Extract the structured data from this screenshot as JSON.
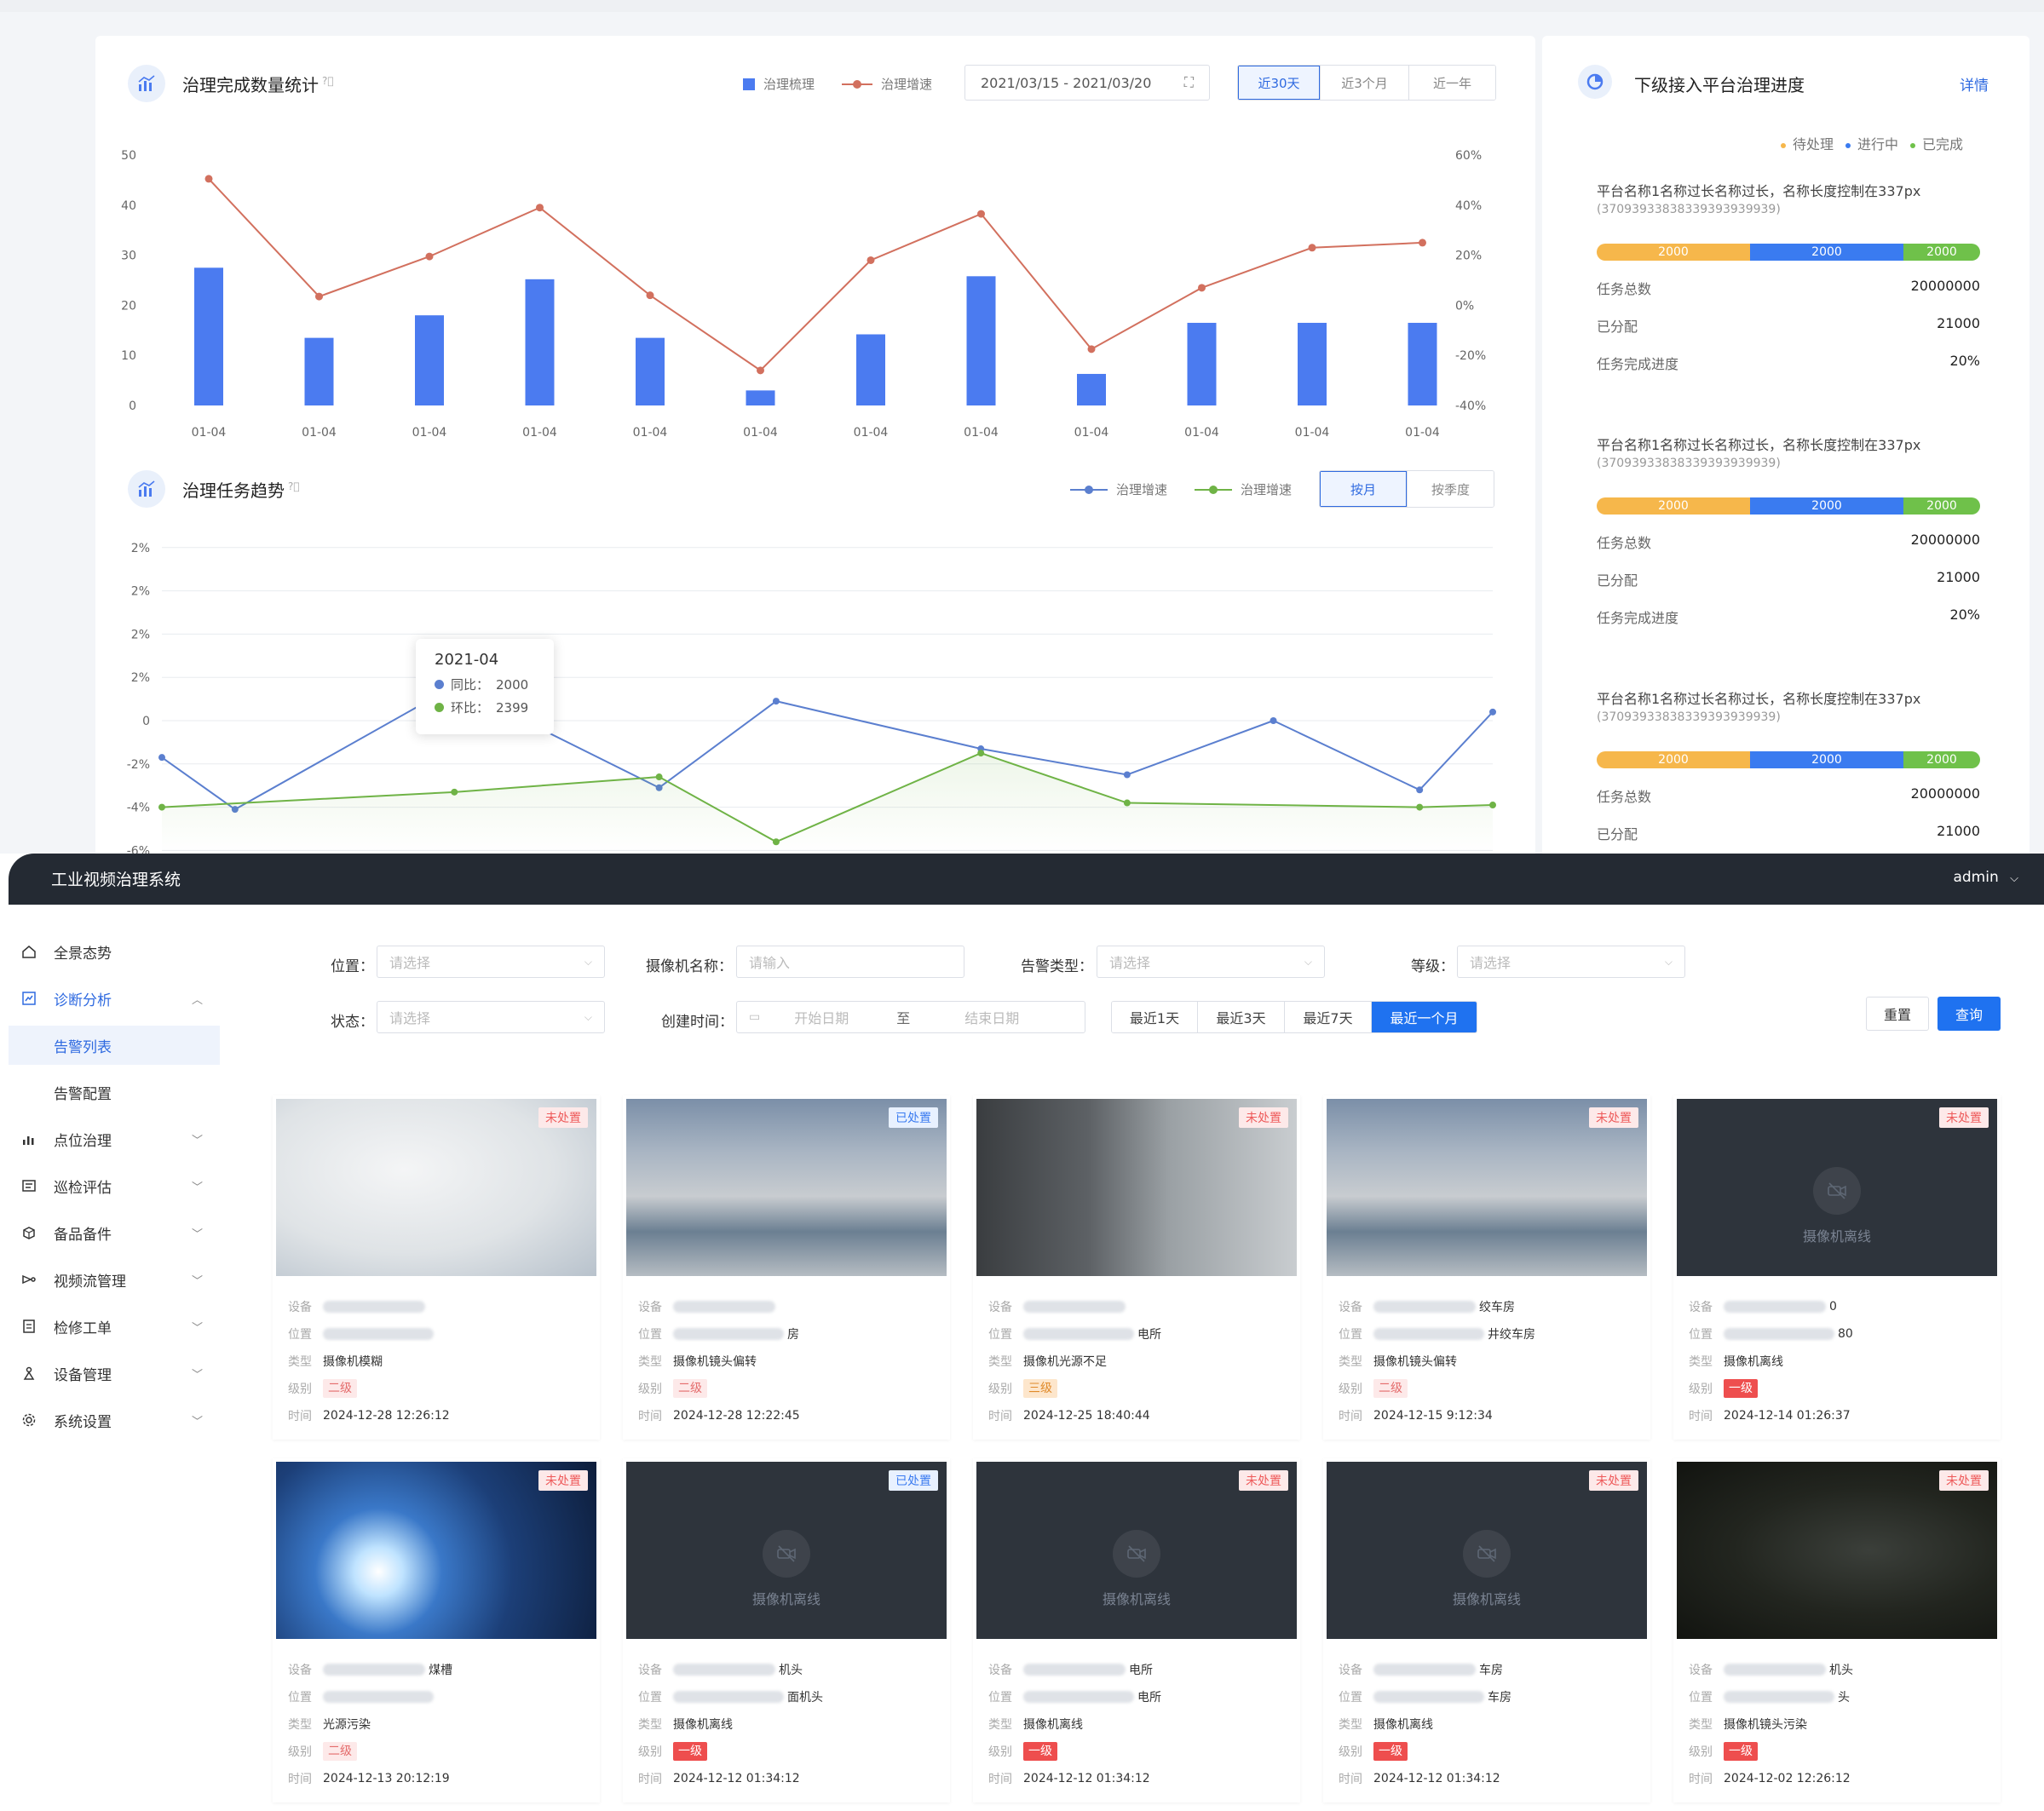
{
  "dashboard": {
    "completion": {
      "title": "治理完成数量统计",
      "help_icon": "question-circle-icon",
      "legend": [
        "治理梳理",
        "治理增速"
      ],
      "date_range": "2021/03/15 - 2021/03/20",
      "ranges": [
        "近30天",
        "近3个月",
        "近一年"
      ],
      "active_range": 0
    },
    "trend": {
      "title": "治理任务趋势",
      "legend": [
        "治理增速",
        "治理增速"
      ],
      "modes": [
        "按月",
        "按季度"
      ],
      "active_mode": 0,
      "tooltip": {
        "title": "2021-04",
        "rows": [
          {
            "label": "同比：",
            "value": "2000"
          },
          {
            "label": "环比：",
            "value": "2399"
          }
        ]
      }
    },
    "progress": {
      "title": "下级接入平台治理进度",
      "detail_link": "详情",
      "legend": [
        "待处理",
        "进行中",
        "已完成"
      ],
      "platforms": [
        {
          "name": "平台名称1名称过长名称过长，名称长度控制在337px",
          "code": "(37093933838339393939939)",
          "bar": [
            "2000",
            "2000",
            "2000"
          ],
          "rows": [
            {
              "k": "任务总数",
              "v": "20000000"
            },
            {
              "k": "已分配",
              "v": "21000"
            },
            {
              "k": "任务完成进度",
              "v": "20%"
            }
          ]
        },
        {
          "name": "平台名称1名称过长名称过长，名称长度控制在337px",
          "code": "(37093933838339393939939)",
          "bar": [
            "2000",
            "2000",
            "2000"
          ],
          "rows": [
            {
              "k": "任务总数",
              "v": "20000000"
            },
            {
              "k": "已分配",
              "v": "21000"
            },
            {
              "k": "任务完成进度",
              "v": "20%"
            }
          ]
        },
        {
          "name": "平台名称1名称过长名称过长，名称长度控制在337px",
          "code": "(37093933838339393939939)",
          "bar": [
            "2000",
            "2000",
            "2000"
          ],
          "rows": [
            {
              "k": "任务总数",
              "v": "20000000"
            },
            {
              "k": "已分配",
              "v": "21000"
            }
          ]
        }
      ]
    }
  },
  "chart_data": [
    {
      "type": "bar",
      "categories": [
        "01-04",
        "01-04",
        "01-04",
        "01-04",
        "01-04",
        "01-04",
        "01-04",
        "01-04",
        "01-04",
        "01-04",
        "01-04",
        "01-04"
      ],
      "ylim": [
        0,
        50
      ],
      "yticks": [
        "0",
        "10",
        "20",
        "30",
        "40",
        "50"
      ],
      "y2lim": [
        -40,
        60
      ],
      "y2ticks": [
        "-40%",
        "-20%",
        "0%",
        "20%",
        "40%",
        "60%"
      ],
      "series": [
        {
          "name": "治理梳理",
          "type": "bar",
          "axis": "left",
          "values": [
            27.5,
            13.5,
            18,
            25.2,
            13.5,
            3,
            14.2,
            25.8,
            6.3,
            16.5,
            16.5,
            16.5
          ]
        },
        {
          "name": "治理增速",
          "type": "line",
          "axis": "right",
          "values": [
            50.5,
            3.5,
            19.5,
            39,
            4,
            -26,
            18,
            36.5,
            -17.5,
            7,
            23,
            25
          ]
        }
      ],
      "grid": false
    },
    {
      "type": "line",
      "x_count": 12,
      "yticks": [
        "-6%",
        "-4%",
        "-2%",
        "0",
        "2%",
        "2%",
        "2%",
        "2%"
      ],
      "ylim": [
        -6,
        8
      ],
      "grid": true,
      "series": [
        {
          "name": "治理增速",
          "color": "#5b7fcf",
          "points": [
            [
              0,
              -1.7
            ],
            [
              0.5,
              -4.1
            ],
            [
              2,
              1.6
            ],
            [
              3.4,
              -3.1
            ],
            [
              4.2,
              0.9
            ],
            [
              5.6,
              -1.3
            ],
            [
              6.6,
              -2.5
            ],
            [
              7.6,
              0.0
            ],
            [
              8.6,
              -3.2
            ],
            [
              9.1,
              0.4
            ]
          ]
        },
        {
          "name": "治理增速",
          "color": "#6fb346",
          "points": [
            [
              0,
              -4.0
            ],
            [
              2,
              -3.3
            ],
            [
              3.4,
              -2.6
            ],
            [
              4.2,
              -5.6
            ],
            [
              5.6,
              -1.5
            ],
            [
              6.6,
              -3.8
            ],
            [
              8.6,
              -4.0
            ],
            [
              9.1,
              -3.9
            ]
          ]
        }
      ]
    }
  ],
  "app": {
    "title": "工业视频治理系统",
    "user": "admin",
    "sidebar": [
      {
        "label": "全景态势",
        "icon": "home-icon",
        "chevron": false
      },
      {
        "label": "诊断分析",
        "icon": "diagnosis-icon",
        "chevron": true,
        "open": true
      },
      {
        "label": "告警列表",
        "sub": true,
        "selected": true
      },
      {
        "label": "告警配置",
        "sub": true
      },
      {
        "label": "点位治理",
        "icon": "chart-icon",
        "chevron": true
      },
      {
        "label": "巡检评估",
        "icon": "inspect-icon",
        "chevron": true
      },
      {
        "label": "备品备件",
        "icon": "box-icon",
        "chevron": true
      },
      {
        "label": "视频流管理",
        "icon": "stream-icon",
        "chevron": true
      },
      {
        "label": "检修工单",
        "icon": "order-icon",
        "chevron": true
      },
      {
        "label": "设备管理",
        "icon": "device-icon",
        "chevron": true
      },
      {
        "label": "系统设置",
        "icon": "gear-icon",
        "chevron": true
      }
    ],
    "filters": {
      "position_label": "位置：",
      "position_ph": "请选择",
      "camera_label": "摄像机名称：",
      "camera_ph": "请输入",
      "alarm_type_label": "告警类型：",
      "alarm_type_ph": "请选择",
      "level_label": "等级：",
      "level_ph": "请选择",
      "status_label": "状态：",
      "status_ph": "请选择",
      "created_label": "创建时间：",
      "start_ph": "开始日期",
      "to": "至",
      "end_ph": "结束日期",
      "quick": [
        "最近1天",
        "最近3天",
        "最近7天",
        "最近一个月"
      ],
      "quick_active": 3,
      "reset": "重置",
      "query": "查询"
    },
    "row_labels": {
      "device": "设备",
      "position": "位置",
      "type": "类型",
      "level": "级别",
      "time": "时间"
    },
    "offline_text": "摄像机离线",
    "alarms": [
      {
        "status": "未处置",
        "thumb": "fog",
        "device_tail": "",
        "pos_tail": "",
        "type": "摄像机模糊",
        "level": "二级",
        "lvl": "l2",
        "time": "2024-12-28 12:26:12"
      },
      {
        "status": "已处置",
        "thumb": "factory",
        "device_tail": "",
        "pos_tail": "房",
        "type": "摄像机镜头偏转",
        "level": "二级",
        "lvl": "l2",
        "time": "2024-12-28 12:22:45"
      },
      {
        "status": "未处置",
        "thumb": "corridor",
        "device_tail": "",
        "pos_tail": "电所",
        "type": "摄像机光源不足",
        "level": "三级",
        "lvl": "l3",
        "time": "2024-12-25 18:40:44"
      },
      {
        "status": "未处置",
        "thumb": "factory",
        "device_tail": "绞车房",
        "pos_tail": "井绞车房",
        "type": "摄像机镜头偏转",
        "level": "二级",
        "lvl": "l2",
        "time": "2024-12-15 9:12:34"
      },
      {
        "status": "未处置",
        "thumb": "offline",
        "device_tail": "0",
        "pos_tail": "80",
        "type": "摄像机离线",
        "level": "一级",
        "lvl": "l1",
        "time": "2024-12-14 01:26:37"
      },
      {
        "status": "未处置",
        "thumb": "light",
        "device_tail": "煤槽",
        "pos_tail": "",
        "type": "光源污染",
        "level": "二级",
        "lvl": "l2",
        "time": "2024-12-13 20:12:19"
      },
      {
        "status": "已处置",
        "thumb": "offline",
        "device_tail": "机头",
        "pos_tail": "面机头",
        "type": "摄像机离线",
        "level": "一级",
        "lvl": "l1",
        "time": "2024-12-12 01:34:12"
      },
      {
        "status": "未处置",
        "thumb": "offline",
        "device_tail": "电所",
        "pos_tail": "电所",
        "type": "摄像机离线",
        "level": "一级",
        "lvl": "l1",
        "time": "2024-12-12 01:34:12"
      },
      {
        "status": "未处置",
        "thumb": "offline",
        "device_tail": "车房",
        "pos_tail": "车房",
        "type": "摄像机离线",
        "level": "一级",
        "lvl": "l1",
        "time": "2024-12-12 01:34:12"
      },
      {
        "status": "未处置",
        "thumb": "tunnel",
        "device_tail": "机头",
        "pos_tail": "头",
        "type": "摄像机镜头污染",
        "level": "一级",
        "lvl": "l1",
        "time": "2024-12-02 12:26:12"
      }
    ]
  },
  "colors": {
    "bar_blue": "#4b7bf0",
    "line_red": "#d2705e",
    "line_blue": "#5b7fcf",
    "line_green": "#6fb346",
    "pending": "#f6b74b",
    "running": "#3a7bf0",
    "done": "#6fc14a",
    "primary": "#1f72f0",
    "header": "#242a33"
  }
}
